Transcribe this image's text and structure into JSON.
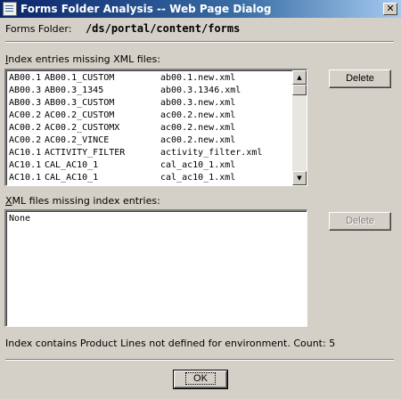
{
  "window": {
    "title": "Forms Folder Analysis -- Web Page Dialog",
    "close_glyph": "✕"
  },
  "folder": {
    "label": "Forms Folder:",
    "path": "/ds/portal/content/forms"
  },
  "index_section": {
    "label_first": "I",
    "label_rest": "ndex entries missing XML files:",
    "rows": [
      [
        "AB00.1",
        "AB00.1_CUSTOM",
        "ab00.1.new.xml"
      ],
      [
        "AB00.3",
        "AB00.3_1345",
        "ab00.3.1346.xml"
      ],
      [
        "AB00.3",
        "AB00.3_CUSTOM",
        "ab00.3.new.xml"
      ],
      [
        "AC00.2",
        "AC00.2_CUSTOM",
        "ac00.2.new.xml"
      ],
      [
        "AC00.2",
        "AC00.2_CUSTOMX",
        "ac00.2.new.xml"
      ],
      [
        "AC00.2",
        "AC00.2_VINCE",
        "ac00.2.new.xml"
      ],
      [
        "AC10.1",
        "ACTIVITY_FILTER",
        "activity_filter.xml"
      ],
      [
        "AC10.1",
        "CAL_AC10_1",
        "cal_ac10_1.xml"
      ],
      [
        "AC10.1",
        "CAL_AC10_1",
        "cal_ac10_1.xml"
      ]
    ],
    "delete_label": "Delete"
  },
  "xml_section": {
    "label_first": "X",
    "label_rest": "ML files missing index entries:",
    "rows": [
      "None"
    ],
    "delete_label": "Delete"
  },
  "status_text": "Index contains Product Lines not defined for environment. Count: 5",
  "ok_label": "OK"
}
